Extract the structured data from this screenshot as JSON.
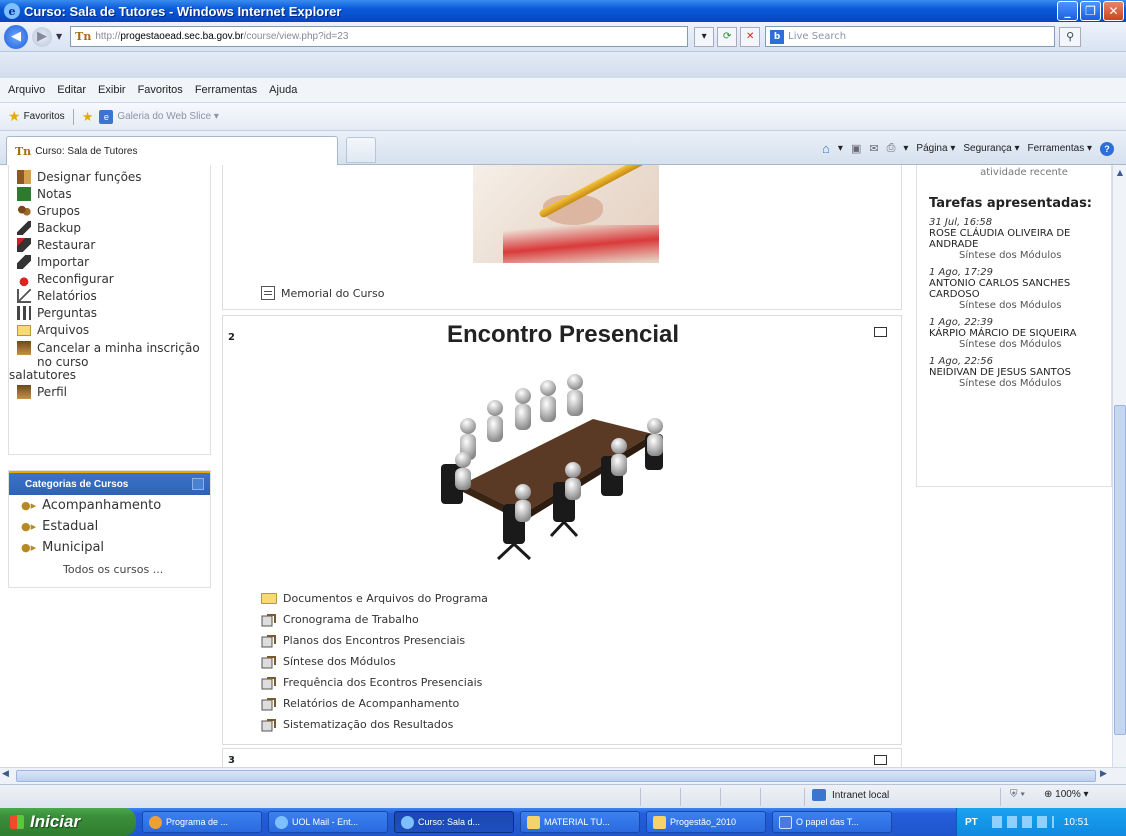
{
  "window": {
    "title": "Curso: Sala de Tutores - Windows Internet Explorer"
  },
  "address": {
    "url_prefix": "http://",
    "url_domain": "progestaoead.sec.ba.gov.br",
    "url_path": "/course/view.php?id=23",
    "search_placeholder": "Live Search"
  },
  "menu": [
    "Arquivo",
    "Editar",
    "Exibir",
    "Favoritos",
    "Ferramentas",
    "Ajuda"
  ],
  "favorites": {
    "label": "Favoritos",
    "web_slice": "Galeria do Web Slice ▾"
  },
  "tab": {
    "label": "Curso: Sala de Tutores"
  },
  "command_bar": {
    "page": "Página ▾",
    "security": "Segurança ▾",
    "tools": "Ferramentas ▾"
  },
  "admin_menu": {
    "items": [
      {
        "label": "Designar funções",
        "icon": "roles-icon"
      },
      {
        "label": "Notas",
        "icon": "grades-icon"
      },
      {
        "label": "Grupos",
        "icon": "groups-icon"
      },
      {
        "label": "Backup",
        "icon": "backup-icon"
      },
      {
        "label": "Restaurar",
        "icon": "restore-icon"
      },
      {
        "label": "Importar",
        "icon": "import-icon"
      },
      {
        "label": "Reconfigurar",
        "icon": "reset-icon"
      },
      {
        "label": "Relatórios",
        "icon": "reports-icon"
      },
      {
        "label": "Perguntas",
        "icon": "questions-icon"
      },
      {
        "label": "Arquivos",
        "icon": "files-icon"
      }
    ],
    "cancel": "Cancelar a minha inscrição no curso",
    "cancel_course": "salatutores",
    "profile": "Perfil"
  },
  "categories": {
    "title": "Categorias de Cursos",
    "items": [
      "Acompanhamento",
      "Estadual",
      "Municipal"
    ],
    "all": "Todos os cursos ..."
  },
  "course": {
    "memorial": "Memorial do Curso",
    "section2": {
      "number": "2",
      "title": "Encontro Presencial",
      "folder": "Documentos e Arquivos do Programa",
      "links": [
        "Cronograma de Trabalho",
        "Planos dos Encontros Presenciais",
        "Síntese dos Módulos",
        "Frequência dos Econtros Presenciais",
        "Relatórios de Acompanhamento",
        "Sistematização dos Resultados"
      ]
    },
    "section3": {
      "number": "3"
    }
  },
  "right": {
    "recent_activity": "atividade recente",
    "tasks_title": "Tarefas apresentadas:",
    "tasks": [
      {
        "date": "31 Jul, 16:58",
        "name": "ROSE CLÁUDIA OLIVEIRA DE ANDRADE",
        "activity": "Síntese dos Módulos"
      },
      {
        "date": "1 Ago, 17:29",
        "name": "ANTONIO CARLOS SANCHES CARDOSO",
        "activity": "Síntese dos Módulos"
      },
      {
        "date": "1 Ago, 22:39",
        "name": "KÁRPIO MÁRCIO DE SIQUEIRA",
        "activity": "Síntese dos Módulos"
      },
      {
        "date": "1 Ago, 22:56",
        "name": "NEIDIVAN DE JESUS SANTOS",
        "activity": "Síntese dos Módulos"
      }
    ]
  },
  "status": {
    "zone": "Intranet local",
    "zoom": "100%"
  },
  "taskbar": {
    "start": "Iniciar",
    "buttons": [
      {
        "label": "Programa de ...",
        "icon": "orange"
      },
      {
        "label": "UOL Mail - Ent...",
        "icon": "ie"
      },
      {
        "label": "Curso: Sala d...",
        "icon": "ie"
      },
      {
        "label": "MATERIAL TU...",
        "icon": "folder"
      },
      {
        "label": "Progestão_2010",
        "icon": "folder"
      },
      {
        "label": "O papel das T...",
        "icon": "word"
      }
    ],
    "lang": "PT",
    "clock": "10:51"
  }
}
